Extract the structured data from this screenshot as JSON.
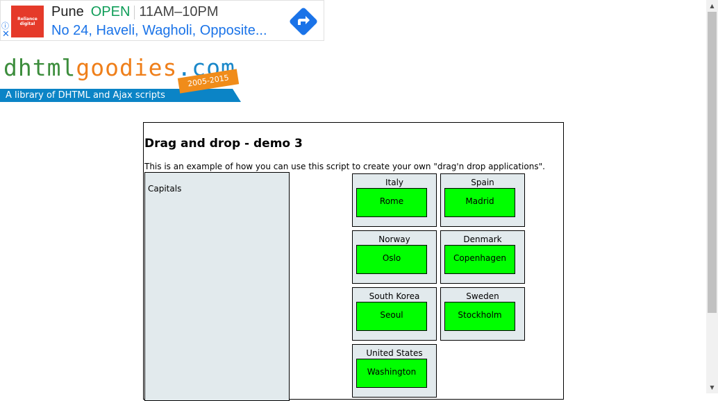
{
  "ad": {
    "logo_text": "Reliance digital",
    "info_icon": "info-icon",
    "close_icon": "close-icon",
    "city": "Pune",
    "status": "OPEN",
    "hours": "11AM–10PM",
    "address": "No 24, Haveli, Wagholi, Opposite...",
    "directions_icon": "directions-icon",
    "colors": {
      "open": "#0f9d58",
      "link": "#1a73e8",
      "logo_bg": "#e53a2a"
    }
  },
  "logo": {
    "part1": "dhtml",
    "part2": "goodies",
    "part3": ".com",
    "years": "2005-2015",
    "tagline": "A library of DHTML and Ajax scripts",
    "colors": {
      "dhtml": "#3c8d3c",
      "goodies": "#ef7f1a",
      "com": "#1987c9",
      "bar": "#0b84c6"
    }
  },
  "demo": {
    "title": "Drag and drop - demo 3",
    "description": "This is an example of how you can use this script to create your own \"drag'n drop applications\".",
    "capitals_label": "Capitals",
    "countries": [
      {
        "name": "Italy",
        "capital": "Rome"
      },
      {
        "name": "Spain",
        "capital": "Madrid"
      },
      {
        "name": "Norway",
        "capital": "Oslo"
      },
      {
        "name": "Denmark",
        "capital": "Copenhagen"
      },
      {
        "name": "South Korea",
        "capital": "Seoul"
      },
      {
        "name": "Sweden",
        "capital": "Stockholm"
      },
      {
        "name": "United States",
        "capital": "Washington"
      }
    ],
    "colors": {
      "panel": "#e2eaed",
      "capital": "#00ff00"
    }
  },
  "scrollbar": {
    "up_icon": "▲",
    "down_icon": "▼"
  }
}
